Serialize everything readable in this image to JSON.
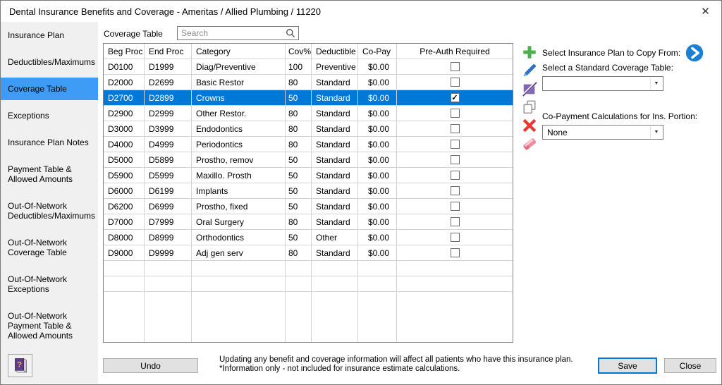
{
  "window": {
    "title": "Dental Insurance Benefits and Coverage - Ameritas / Allied Plumbing / 11220",
    "close_glyph": "✕"
  },
  "sidebar": {
    "items": [
      {
        "label": "Insurance Plan",
        "selected": false
      },
      {
        "label": "Deductibles/Maximums",
        "selected": false
      },
      {
        "label": "Coverage Table",
        "selected": true
      },
      {
        "label": "Exceptions",
        "selected": false
      },
      {
        "label": "Insurance Plan Notes",
        "selected": false
      },
      {
        "label": "Payment Table & Allowed Amounts",
        "selected": false
      },
      {
        "label": "Out-Of-Network Deductibles/Maximums",
        "selected": false
      },
      {
        "label": "Out-Of-Network Coverage Table",
        "selected": false
      },
      {
        "label": "Out-Of-Network Exceptions",
        "selected": false
      },
      {
        "label": "Out-Of-Network Payment Table & Allowed Amounts",
        "selected": false
      }
    ]
  },
  "main": {
    "grid_label": "Coverage Table",
    "search_placeholder": "Search",
    "table": {
      "columns": [
        "Beg Proc",
        "End Proc",
        "Category",
        "Cov%",
        "Deductible",
        "Co-Pay",
        "Pre-Auth Required"
      ],
      "rows": [
        {
          "beg_proc": "D0100",
          "end_proc": "D1999",
          "category": "Diag/Preventive",
          "cov_pct": "100",
          "deductible": "Preventive",
          "co_pay": "$0.00",
          "pre_auth": false,
          "selected": false
        },
        {
          "beg_proc": "D2000",
          "end_proc": "D2699",
          "category": "Basic Restor",
          "cov_pct": "80",
          "deductible": "Standard",
          "co_pay": "$0.00",
          "pre_auth": false,
          "selected": false
        },
        {
          "beg_proc": "D2700",
          "end_proc": "D2899",
          "category": "Crowns",
          "cov_pct": "50",
          "deductible": "Standard",
          "co_pay": "$0.00",
          "pre_auth": true,
          "selected": true
        },
        {
          "beg_proc": "D2900",
          "end_proc": "D2999",
          "category": "Other Restor.",
          "cov_pct": "80",
          "deductible": "Standard",
          "co_pay": "$0.00",
          "pre_auth": false,
          "selected": false
        },
        {
          "beg_proc": "D3000",
          "end_proc": "D3999",
          "category": "Endodontics",
          "cov_pct": "80",
          "deductible": "Standard",
          "co_pay": "$0.00",
          "pre_auth": false,
          "selected": false
        },
        {
          "beg_proc": "D4000",
          "end_proc": "D4999",
          "category": "Periodontics",
          "cov_pct": "80",
          "deductible": "Standard",
          "co_pay": "$0.00",
          "pre_auth": false,
          "selected": false
        },
        {
          "beg_proc": "D5000",
          "end_proc": "D5899",
          "category": "Prostho, remov",
          "cov_pct": "50",
          "deductible": "Standard",
          "co_pay": "$0.00",
          "pre_auth": false,
          "selected": false
        },
        {
          "beg_proc": "D5900",
          "end_proc": "D5999",
          "category": "Maxillo. Prosth",
          "cov_pct": "50",
          "deductible": "Standard",
          "co_pay": "$0.00",
          "pre_auth": false,
          "selected": false
        },
        {
          "beg_proc": "D6000",
          "end_proc": "D6199",
          "category": "Implants",
          "cov_pct": "50",
          "deductible": "Standard",
          "co_pay": "$0.00",
          "pre_auth": false,
          "selected": false
        },
        {
          "beg_proc": "D6200",
          "end_proc": "D6999",
          "category": "Prostho, fixed",
          "cov_pct": "50",
          "deductible": "Standard",
          "co_pay": "$0.00",
          "pre_auth": false,
          "selected": false
        },
        {
          "beg_proc": "D7000",
          "end_proc": "D7999",
          "category": "Oral Surgery",
          "cov_pct": "80",
          "deductible": "Standard",
          "co_pay": "$0.00",
          "pre_auth": false,
          "selected": false
        },
        {
          "beg_proc": "D8000",
          "end_proc": "D8999",
          "category": "Orthodontics",
          "cov_pct": "50",
          "deductible": "Other",
          "co_pay": "$0.00",
          "pre_auth": false,
          "selected": false
        },
        {
          "beg_proc": "D9000",
          "end_proc": "D9999",
          "category": "Adj gen serv",
          "cov_pct": "80",
          "deductible": "Standard",
          "co_pay": "$0.00",
          "pre_auth": false,
          "selected": false
        }
      ]
    }
  },
  "right_panel": {
    "copy_from_label": "Select Insurance Plan to Copy From:",
    "standard_table_label": "Select a Standard Coverage Table:",
    "standard_table_value": "",
    "copay_calc_label": "Co-Payment Calculations for Ins. Portion:",
    "copay_calc_value": "None",
    "dropdown_arrow_glyph": "▼"
  },
  "footer": {
    "undo_label": "Undo",
    "note_line1": "Updating any benefit and coverage information will affect all patients who have this insurance plan.",
    "note_line2": "*Information only - not included for insurance estimate calculations.",
    "save_label": "Save",
    "close_label": "Close"
  },
  "icons": {
    "search": "magnifier",
    "add": "green-plus",
    "edit": "blue-pencil",
    "edit_multiple": "purple-pencil-slash",
    "copy": "copy-pages",
    "delete": "red-x",
    "clear": "pink-eraser",
    "copy_from": "blue-circle-right-arrow",
    "help": "purple-book-question",
    "checkmark_glyph": "✓"
  },
  "colors": {
    "row_selected": "#0078d7",
    "sidebar_selected": "#3e9cf6",
    "add_green": "#4caf50",
    "delete_red": "#e53935",
    "edit_blue": "#2f74c0",
    "edit_purple": "#8265b5",
    "eraser_pink": "#f48a9b",
    "arrow_blue": "#1b7fd4",
    "save_border": "#0078d7"
  }
}
